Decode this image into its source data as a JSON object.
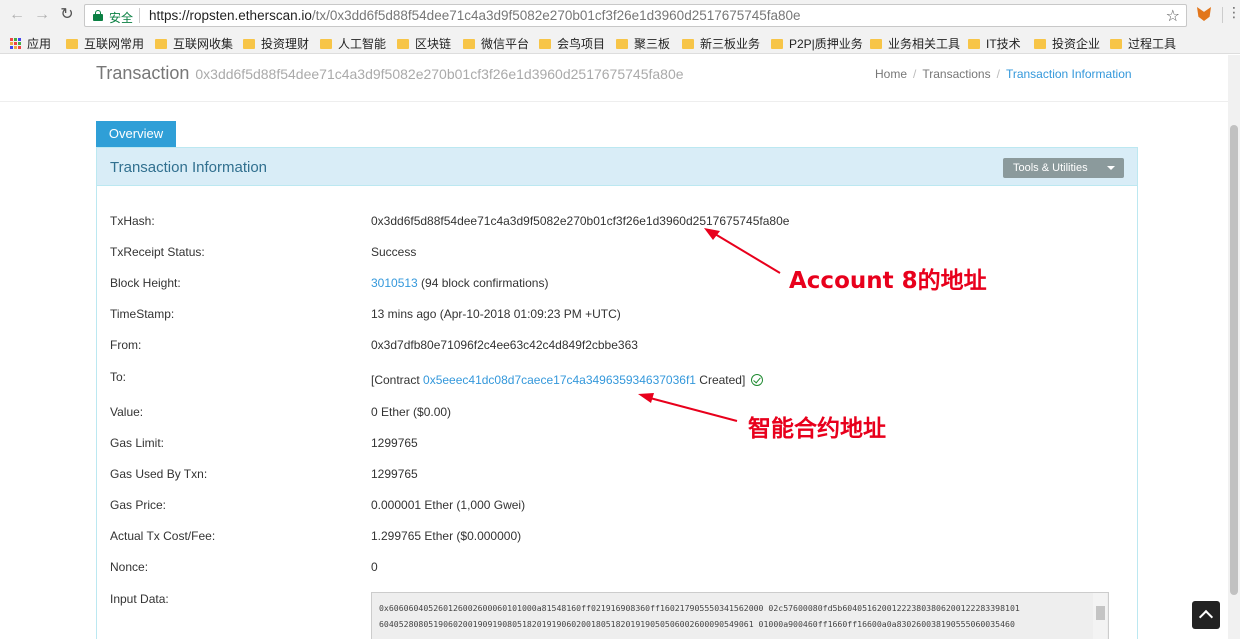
{
  "browser": {
    "secure_label": "安全",
    "url_host": "https://ropsten.etherscan.io",
    "url_path": "/tx/0x3dd6f5d88f54dee71c4a3d9f5082e270b01cf3f26e1d3960d2517675745fa80e",
    "icons": {
      "back": "back-arrow-icon",
      "forward": "forward-arrow-icon",
      "reload": "reload-icon",
      "lock": "lock-icon",
      "star": "star-icon",
      "extension": "metamask-fox-icon"
    }
  },
  "bookmarks": [
    "应用",
    "互联网常用",
    "互联网收集",
    "投资理财",
    "人工智能",
    "区块链",
    "微信平台",
    "会鸟项目",
    "聚三板",
    "新三板业务",
    "P2P|质押业务",
    "业务相关工具",
    "IT技术",
    "投资企业",
    "过程工具"
  ],
  "header": {
    "title": "Transaction",
    "hash": "0x3dd6f5d88f54dee71c4a3d9f5082e270b01cf3f26e1d3960d2517675745fa80e",
    "breadcrumb": [
      "Home",
      "Transactions",
      "Transaction Information"
    ]
  },
  "tabs": {
    "overview": "Overview"
  },
  "panel": {
    "title": "Transaction Information",
    "tools_label": "Tools & Utilities"
  },
  "rows": {
    "txhash": {
      "label": "TxHash:",
      "value": "0x3dd6f5d88f54dee71c4a3d9f5082e270b01cf3f26e1d3960d2517675745fa80e"
    },
    "status": {
      "label": "TxReceipt Status:",
      "value": "Success"
    },
    "block": {
      "label": "Block Height:",
      "link": "3010513",
      "rest": " (94 block confirmations)"
    },
    "timestamp": {
      "label": "TimeStamp:",
      "value": "13 mins ago (Apr-10-2018 01:09:23 PM +UTC)"
    },
    "from": {
      "label": "From:",
      "value": "0x3d7dfb80e71096f2c4ee63c42c4d849f2cbbe363"
    },
    "to": {
      "label": "To:",
      "prefix": "[Contract ",
      "link": "0x5eeec41dc08d7caece17c4a349635934637036f1",
      "suffix": " Created]"
    },
    "value": {
      "label": "Value:",
      "value": "0 Ether ($0.00)"
    },
    "gas_limit": {
      "label": "Gas Limit:",
      "value": "1299765"
    },
    "gas_used": {
      "label": "Gas Used By Txn:",
      "value": "1299765"
    },
    "gas_price": {
      "label": "Gas Price:",
      "value": "0.000001 Ether (1,000 Gwei)"
    },
    "fee": {
      "label": "Actual Tx Cost/Fee:",
      "value": "1.299765 Ether ($0.000000)"
    },
    "nonce": {
      "label": "Nonce:",
      "value": "0"
    },
    "input": {
      "label": "Input Data:",
      "line1": "0x606060405260126002600060101000a81548160ff021916908360ff160217905550341562000 02c57600080fd5b604051620012223803806200122283398101",
      "line2": "6040528080519060200190919080518201919060200180518201919050506002600090549061 01000a900460ff1660ff16600a0a830260038190555060035460"
    }
  },
  "annotations": {
    "account": "Account 8的地址",
    "contract": "智能合约地址"
  },
  "colors": {
    "link": "#3498db",
    "tab": "#2f9fd7",
    "annotation": "#e8001c",
    "success": "#1e8a30"
  }
}
